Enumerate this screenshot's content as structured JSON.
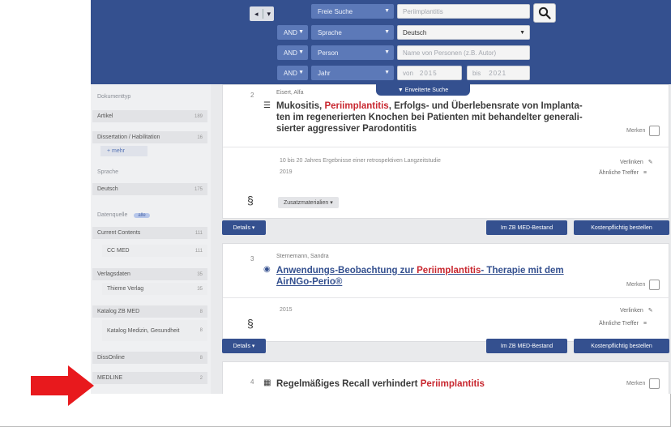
{
  "header": {
    "nav": {
      "left": "◂",
      "drop": "▾"
    },
    "row1": {
      "field": "Freie Suche",
      "value": "Periimplantitis"
    },
    "row2": {
      "op": "AND",
      "field": "Sprache",
      "value": "Deutsch"
    },
    "row3": {
      "op": "AND",
      "field": "Person",
      "placeholder": "Name von Personen (z.B. Autor)"
    },
    "row4": {
      "op": "AND",
      "field": "Jahr",
      "from_label": "von",
      "from_value": "2015",
      "to_label": "bis",
      "to_value": "2021"
    },
    "advanced_tab": "▼ Erweiterte Suche"
  },
  "sidebar": {
    "dokumenttyp": {
      "label": "Dokumenttyp",
      "items": [
        {
          "label": "Artikel",
          "count": "189"
        },
        {
          "label": "Dissertation / Habilitation",
          "count": "16"
        }
      ],
      "more": "+ mehr"
    },
    "sprache": {
      "label": "Sprache",
      "items": [
        {
          "label": "Deutsch",
          "count": "175"
        }
      ]
    },
    "datenquelle": {
      "label": "Datenquelle",
      "badge": "alle",
      "items": [
        {
          "label": "Current Contents",
          "count": "111"
        },
        {
          "label": "CC MED",
          "count": "111"
        },
        {
          "label": "Verlagsdaten",
          "count": "35"
        },
        {
          "label": "Thieme Verlag",
          "count": "35"
        },
        {
          "label": "Katalog ZB MED",
          "count": "8"
        },
        {
          "label": "Katalog Medizin, Gesundheit",
          "count": "8"
        },
        {
          "label": "DissOnline",
          "count": "8"
        },
        {
          "label": "MEDLINE",
          "count": "2"
        }
      ]
    }
  },
  "results": [
    {
      "num": "2",
      "author": "Eisert, Alfa",
      "title_pre": "Mukositis, ",
      "title_hl": "Periimplantitis",
      "title_post": ", Erfolgs- und Überlebensrate von Implanta-",
      "title_line2": "ten im regenerierten Knochen bei Patienten mit behandelter generali-",
      "title_line3": "sierter aggressiver Parodontitis",
      "description": "10 bis 20 Jahres Ergebnisse einer retrospektiven Langzeitstudie",
      "year": "2019",
      "zusatz": "Zusatzmaterialien ▾"
    },
    {
      "num": "3",
      "author": "Sternemann, Sandra",
      "title_pre": "Anwendungs-Beobachtung zur ",
      "title_hl": "Periimplantitis",
      "title_post": "- Therapie mit dem",
      "title_line2": "AirNGo-Perio®",
      "year": "2015"
    },
    {
      "num": "4",
      "title_pre": "Regelmäßiges Recall verhindert ",
      "title_hl": "Periimplantitis"
    }
  ],
  "actions": {
    "merken": "Merken",
    "verlinken": "Verlinken",
    "aehnliche": "Ähnliche Treffer",
    "details": "Details ▾",
    "bestand": "Im ZB MED-Bestand",
    "bestellen": "Kostenpflichtig bestellen"
  },
  "colors": {
    "header": "#34508f",
    "highlight": "#c8272f",
    "arrow": "#e8191d"
  }
}
